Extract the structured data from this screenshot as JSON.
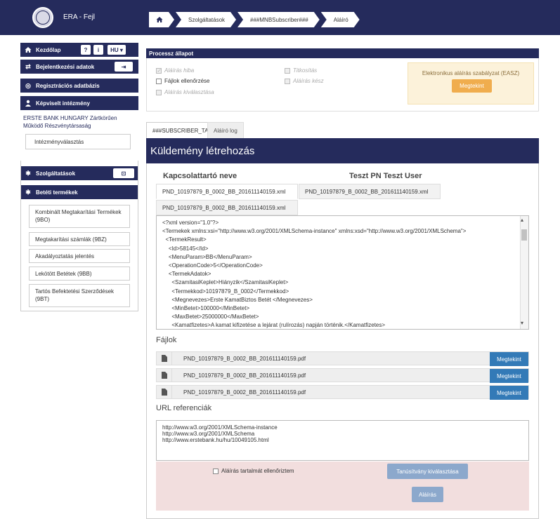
{
  "app": {
    "title": "ERA - Fejl"
  },
  "breadcrumb": [
    "Szolgáltatások",
    "###MNBSubscriber###",
    "Aláíró"
  ],
  "sidebar": {
    "home_label": "Kezdőlap",
    "lang_label": "HU",
    "login_label": "Bejelentkezési adatok",
    "registry_label": "Regisztrációs adatbázis",
    "represented_label": "Képviselt intézmény",
    "org_name": "ERSTE BANK HUNGARY Zártkörűen Működő Részvénytársaság",
    "inst_select_label": "Intézményválasztás",
    "services_label": "Szolgáltatások",
    "deposit_label": "Betéti termékek",
    "products": [
      "Kombinált Megtakarítási Termékek (9BO)",
      "Megtakarítási számlák (9BZ)",
      "Akadályoztatás jelentés",
      "Lekötött Betétek (9BB)",
      "Tartós Befektetési Szerződések (9BT)"
    ]
  },
  "process": {
    "header": "Processz állapot",
    "items": {
      "sign_error": "Aláírás hiba",
      "file_check": "Fájlok ellenőrzése",
      "sign_select": "Aláírás kiválasztása",
      "encryption": "Titkosítás",
      "sign_ready": "Aláírás kész"
    },
    "easz_text": "Elektronikus aláírás szabályzat (EASZ)",
    "easz_button": "Megtekint"
  },
  "tabs": {
    "subscriber": "###SUBSCRIBER_TAB###",
    "log": "Aláíró log"
  },
  "main": {
    "header": "Küldemény létrehozás",
    "col_provider": "Kapcsolattartó neve",
    "col_user": "Teszt PN Teszt User",
    "xml_tabs": [
      "PND_10197879_B_0002_BB_201611140159.xml",
      "PND_10197879_B_0002_BB_201611140159.xml",
      "PND_10197879_B_0002_BB_201611140159.xml"
    ],
    "xml_lines": [
      "<?xml version=\"1.0\"?>",
      "<Termekek xmlns:xsi=\"http://www.w3.org/2001/XMLSchema-instance\" xmlns:xsd=\"http://www.w3.org/2001/XMLSchema\">",
      "  <TermekResult>",
      "    <Id>58145</Id>",
      "    <MenuParam>BB</MenuParam>",
      "    <OperationCode>5</OperationCode>",
      "    <TermekAdatok>",
      "      <SzamitasiKeplet>Hiányzik</SzamitasiKeplet>",
      "      <Termekkod>10197879_B_0002</Termekkod>",
      "      <Megnevezes>Erste KamatBiztos Betét </Megnevezes>",
      "      <MinBetet>100000</MinBetet>",
      "      <MaxBetet>25000000</MaxBetet>",
      "      <Kamatfizetes>A kamat kifizetése a lejárat (rulírozás) napján történik.</Kamatfizetes>"
    ],
    "files_label": "Fájlok",
    "files": [
      "PND_10197879_B_0002_BB_201611140159.pdf",
      "PND_10197879_B_0002_BB_201611140159.pdf",
      "PND_10197879_B_0002_BB_201611140159.pdf"
    ],
    "file_button": "Megtekint",
    "url_label": "URL referenciák",
    "urls": [
      "http://www.w3.org/2001/XMLSchema-instance",
      "http://www.w3.org/2001/XMLSchema",
      "http://www.erstebank.hu/hu/10049105.html"
    ],
    "sign_check_label": "Aláírás tartalmát ellenőriztem",
    "cert_button": "Tanúsítvány kiválasztása",
    "sign_button": "Aláírás"
  },
  "colors": {
    "navy": "#252b5c",
    "warning": "#f0ad4e",
    "primary": "#337ab7",
    "danger_bg": "#f2dede"
  }
}
